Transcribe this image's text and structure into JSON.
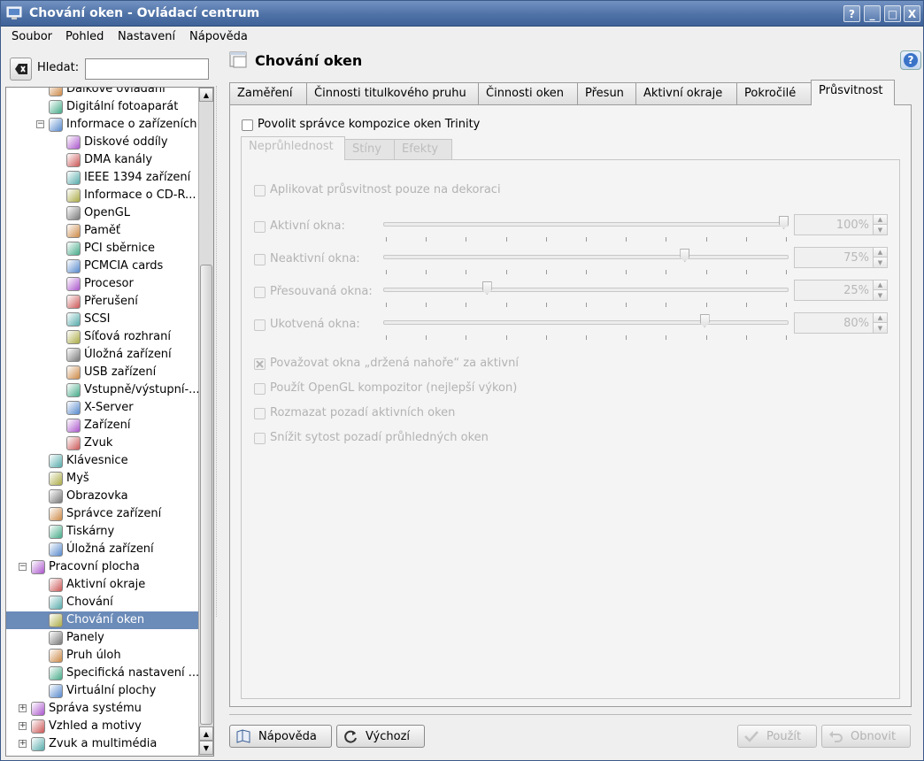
{
  "window": {
    "title": "Chování oken - Ovládací centrum",
    "buttons": {
      "help": "?",
      "minimize": "_",
      "maximize": "□",
      "close": "X"
    }
  },
  "menubar": [
    "Soubor",
    "Pohled",
    "Nastavení",
    "Nápověda"
  ],
  "search": {
    "label": "Hledat:",
    "value": ""
  },
  "tree": [
    {
      "label": "Dálkové ovládání",
      "icon": "remote-control-icon",
      "indent": 2
    },
    {
      "label": "Digitální fotoaparát",
      "icon": "camera-icon",
      "indent": 2
    },
    {
      "label": "Informace o zařízeních",
      "icon": "hardware-info-icon",
      "indent": 2,
      "expanded": true
    },
    {
      "label": "Diskové oddíly",
      "icon": "partition-icon",
      "indent": 3
    },
    {
      "label": "DMA kanály",
      "icon": "dma-icon",
      "indent": 3
    },
    {
      "label": "IEEE 1394 zařízení",
      "icon": "firewire-icon",
      "indent": 3
    },
    {
      "label": "Informace o CD-R...",
      "icon": "cdrom-icon",
      "indent": 3
    },
    {
      "label": "OpenGL",
      "icon": "opengl-icon",
      "indent": 3
    },
    {
      "label": "Paměť",
      "icon": "memory-icon",
      "indent": 3
    },
    {
      "label": "PCI sběrnice",
      "icon": "pci-icon",
      "indent": 3
    },
    {
      "label": "PCMCIA cards",
      "icon": "pcmcia-icon",
      "indent": 3
    },
    {
      "label": "Procesor",
      "icon": "cpu-icon",
      "indent": 3
    },
    {
      "label": "Přerušení",
      "icon": "interrupt-icon",
      "indent": 3
    },
    {
      "label": "SCSI",
      "icon": "scsi-icon",
      "indent": 3
    },
    {
      "label": "Síťová rozhraní",
      "icon": "network-icon",
      "indent": 3
    },
    {
      "label": "Úložná zařízení",
      "icon": "storage-icon",
      "indent": 3
    },
    {
      "label": "USB zařízení",
      "icon": "usb-icon",
      "indent": 3
    },
    {
      "label": "Vstupně/výstupní-...",
      "icon": "io-icon",
      "indent": 3
    },
    {
      "label": "X-Server",
      "icon": "xserver-icon",
      "indent": 3
    },
    {
      "label": "Zařízení",
      "icon": "devices-icon",
      "indent": 3
    },
    {
      "label": "Zvuk",
      "icon": "sound-icon",
      "indent": 3
    },
    {
      "label": "Klávesnice",
      "icon": "keyboard-icon",
      "indent": 2
    },
    {
      "label": "Myš",
      "icon": "mouse-icon",
      "indent": 2
    },
    {
      "label": "Obrazovka",
      "icon": "display-icon",
      "indent": 2
    },
    {
      "label": "Správce zařízení",
      "icon": "device-manager-icon",
      "indent": 2
    },
    {
      "label": "Tiskárny",
      "icon": "printer-icon",
      "indent": 2
    },
    {
      "label": "Úložná zařízení",
      "icon": "storage-icon",
      "indent": 2
    },
    {
      "label": "Pracovní plocha",
      "icon": "desktop-icon",
      "indent": 1,
      "expanded": true
    },
    {
      "label": "Aktivní okraje",
      "icon": "active-borders-icon",
      "indent": 2
    },
    {
      "label": "Chování",
      "icon": "behavior-icon",
      "indent": 2
    },
    {
      "label": "Chování oken",
      "icon": "window-behavior-icon",
      "indent": 2,
      "selected": true
    },
    {
      "label": "Panely",
      "icon": "panels-icon",
      "indent": 2
    },
    {
      "label": "Pruh úloh",
      "icon": "taskbar-icon",
      "indent": 2
    },
    {
      "label": "Specifická nastavení ...",
      "icon": "window-specific-icon",
      "indent": 2
    },
    {
      "label": "Virtuální plochy",
      "icon": "virtual-desktops-icon",
      "indent": 2
    },
    {
      "label": "Správa systému",
      "icon": "system-admin-icon",
      "indent": 1,
      "expanded": false
    },
    {
      "label": "Vzhled a motivy",
      "icon": "appearance-icon",
      "indent": 1,
      "expanded": false
    },
    {
      "label": "Zvuk a multimédia",
      "icon": "multimedia-icon",
      "indent": 1,
      "expanded": false
    }
  ],
  "module": {
    "title": "Chování oken"
  },
  "tabs": [
    "Zaměření",
    "Činnosti titulkového pruhu",
    "Činnosti oken",
    "Přesun",
    "Aktivní okraje",
    "Pokročilé",
    "Průsvitnost"
  ],
  "active_tab": "Průsvitnost",
  "enable_composite": {
    "label": "Povolit správce kompozice oken Trinity",
    "checked": false
  },
  "subtabs": [
    "Neprůhlednost",
    "Stíny",
    "Efekty"
  ],
  "opacity": {
    "decorations_only": {
      "label": "Aplikovat průsvitnost pouze na dekoraci",
      "checked": false
    },
    "sliders": [
      {
        "label": "Aktivní okna:",
        "value": "100%",
        "level": 100
      },
      {
        "label": "Neaktivní okna:",
        "value": "75%",
        "level": 75
      },
      {
        "label": "Přesouvaná okna:",
        "value": "25%",
        "level": 25
      },
      {
        "label": "Ukotvená okna:",
        "value": "80%",
        "level": 80
      }
    ],
    "options": [
      {
        "label": "Považovat okna „držená nahoře“ za aktivní",
        "checked": true
      },
      {
        "label": "Použít OpenGL kompozitor (nejlepší výkon)",
        "checked": false
      },
      {
        "label": "Rozmazat pozadí aktivních oken",
        "checked": false
      },
      {
        "label": "Snížit sytost pozadí průhledných oken",
        "checked": false
      }
    ]
  },
  "buttons": {
    "help": "Nápověda",
    "defaults": "Výchozí",
    "apply": "Použít",
    "reset": "Obnovit"
  }
}
